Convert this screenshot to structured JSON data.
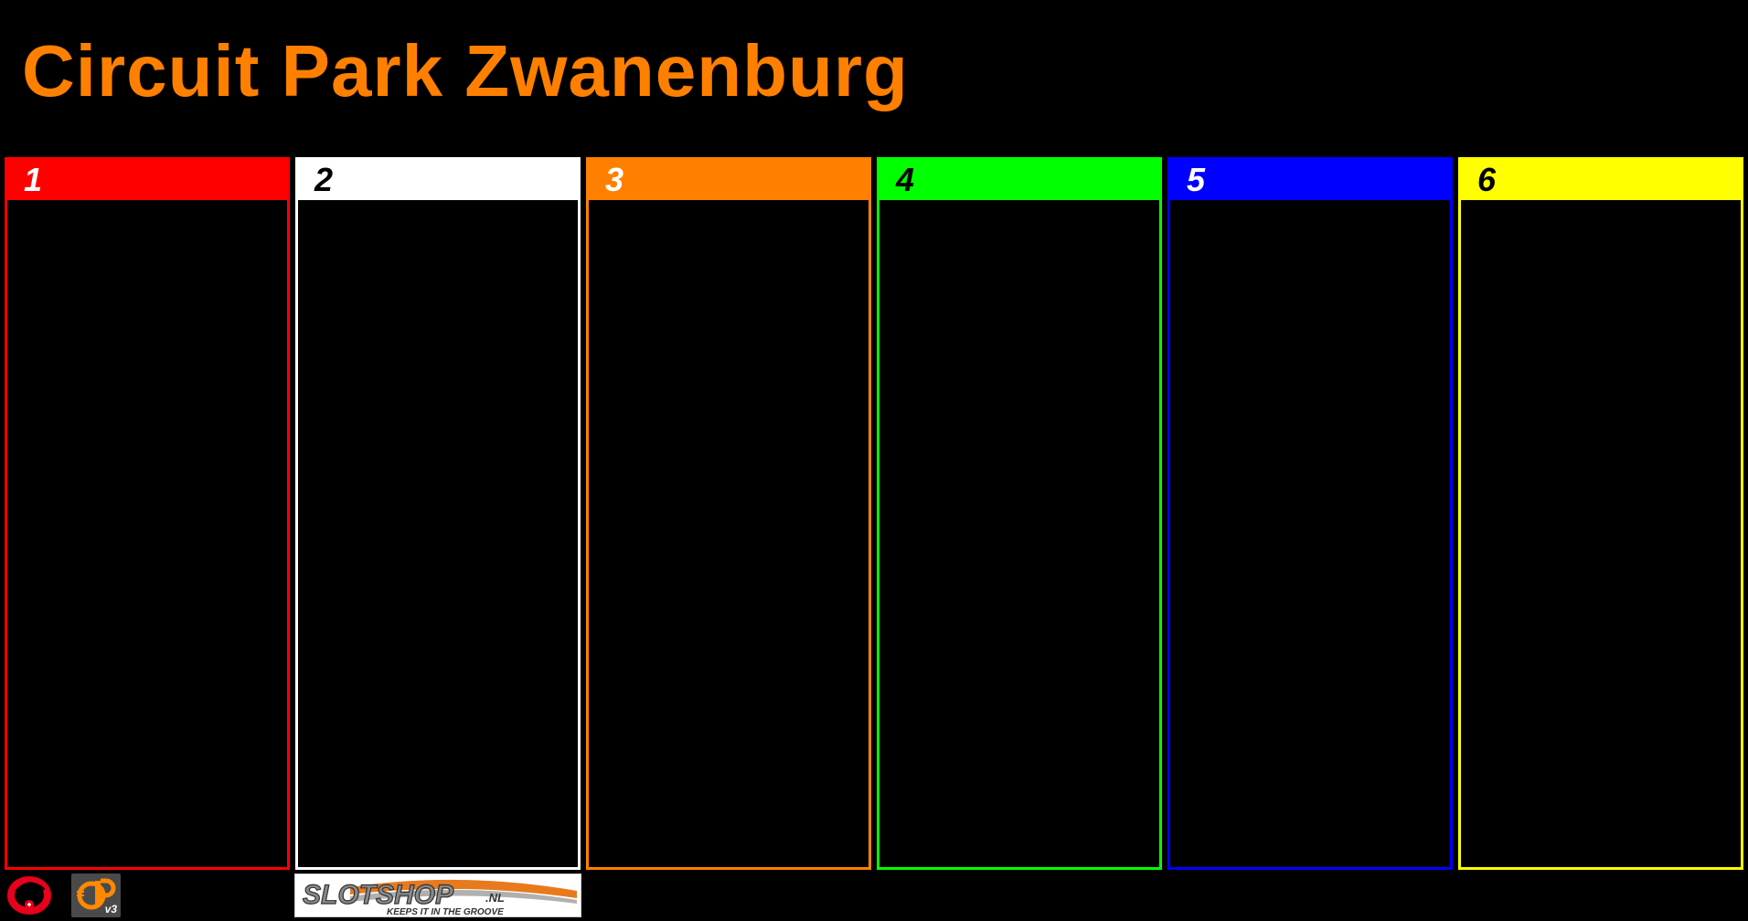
{
  "title": "Circuit Park Zwanenburg",
  "colors": {
    "title": "#FF8000",
    "background": "#000000"
  },
  "lanes": [
    {
      "number": "1",
      "color": "#FF0000",
      "number_color": "#FFFFFF"
    },
    {
      "number": "2",
      "color": "#FFFFFF",
      "number_color": "#000000"
    },
    {
      "number": "3",
      "color": "#FF8000",
      "number_color": "#FFFFFF"
    },
    {
      "number": "4",
      "color": "#00FF00",
      "number_color": "#000000"
    },
    {
      "number": "5",
      "color": "#0000FF",
      "number_color": "#FFFFFF"
    },
    {
      "number": "6",
      "color": "#FFFF00",
      "number_color": "#000000"
    }
  ],
  "footer": {
    "logo_app": "app-logo-icon",
    "logo_v3": {
      "icon": "v3-logo-icon",
      "text": "v3"
    },
    "sponsor": {
      "icon": "slotshop-logo",
      "name": "SLOTSHOP",
      "suffix": ".NL",
      "tagline": "KEEPS IT IN THE GROOVE"
    }
  }
}
